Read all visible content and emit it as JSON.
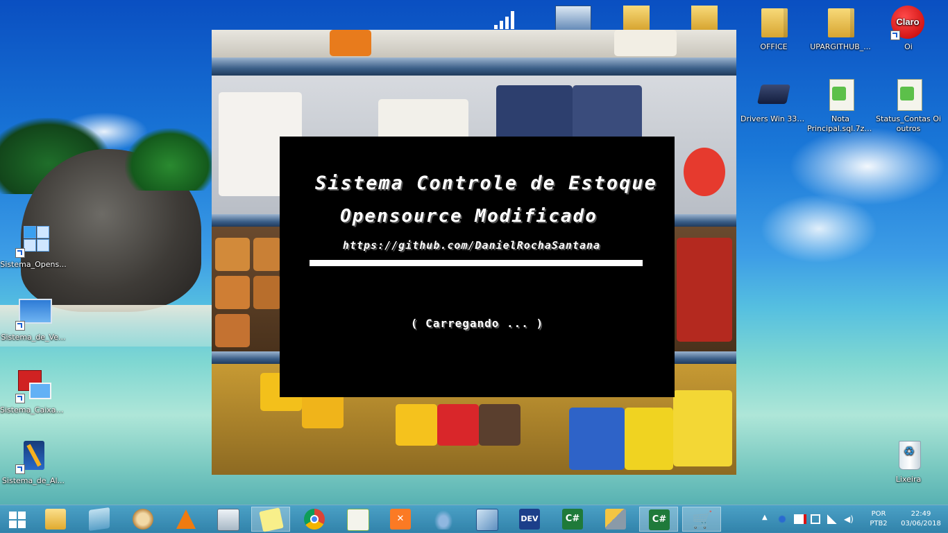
{
  "desktop": {
    "right_icons": [
      {
        "label": "OFFICE"
      },
      {
        "label": "UPARGITHUB_..."
      },
      {
        "label": "Oi",
        "logo_text": "Claro"
      },
      {
        "label": "Drivers Win 330m"
      },
      {
        "label": "Nota Principal.sql.7z...."
      },
      {
        "label": "Status_Contas Oi outros"
      }
    ],
    "left_icons": [
      {
        "label": "Sistema_Opens..."
      },
      {
        "label": "Sistema_de_Ve..."
      },
      {
        "label": "Sistema_Caixa_..."
      },
      {
        "label": "Sistema_de_Al..."
      }
    ],
    "recycle_bin": {
      "label": "Lixeira"
    }
  },
  "splash": {
    "title_line1": "Sistema Controle de Estoque",
    "title_line2": "Opensource Modificado",
    "url": "https://github.com/DanielRochaSantana",
    "loading": "( Carregando ... )",
    "progress_percent": 100
  },
  "taskbar": {
    "pinned": [
      {
        "name": "file-explorer-icon"
      },
      {
        "name": "windows-store-icon"
      },
      {
        "name": "paint-icon"
      },
      {
        "name": "vlc-icon"
      },
      {
        "name": "calculator-icon"
      },
      {
        "name": "sticky-notes-icon"
      },
      {
        "name": "chrome-icon"
      },
      {
        "name": "notepad-plus-plus-icon"
      },
      {
        "name": "xampp-icon"
      },
      {
        "name": "mysql-dolphin-icon"
      },
      {
        "name": "virtualbox-icon"
      },
      {
        "name": "dev-cpp-icon",
        "text": "DEV"
      },
      {
        "name": "csharp-icon",
        "text": "C#"
      },
      {
        "name": "tools-icon"
      },
      {
        "name": "csharp-active-icon",
        "text": "C#"
      },
      {
        "name": "shopping-cart-icon"
      }
    ],
    "tray": {
      "language": "POR",
      "layout": "PTB2",
      "time": "22:49",
      "date": "03/06/2018"
    }
  },
  "colors": {
    "splash_background": "#000000",
    "splash_text": "#ffffff",
    "taskbar": "#3b8fb8"
  }
}
